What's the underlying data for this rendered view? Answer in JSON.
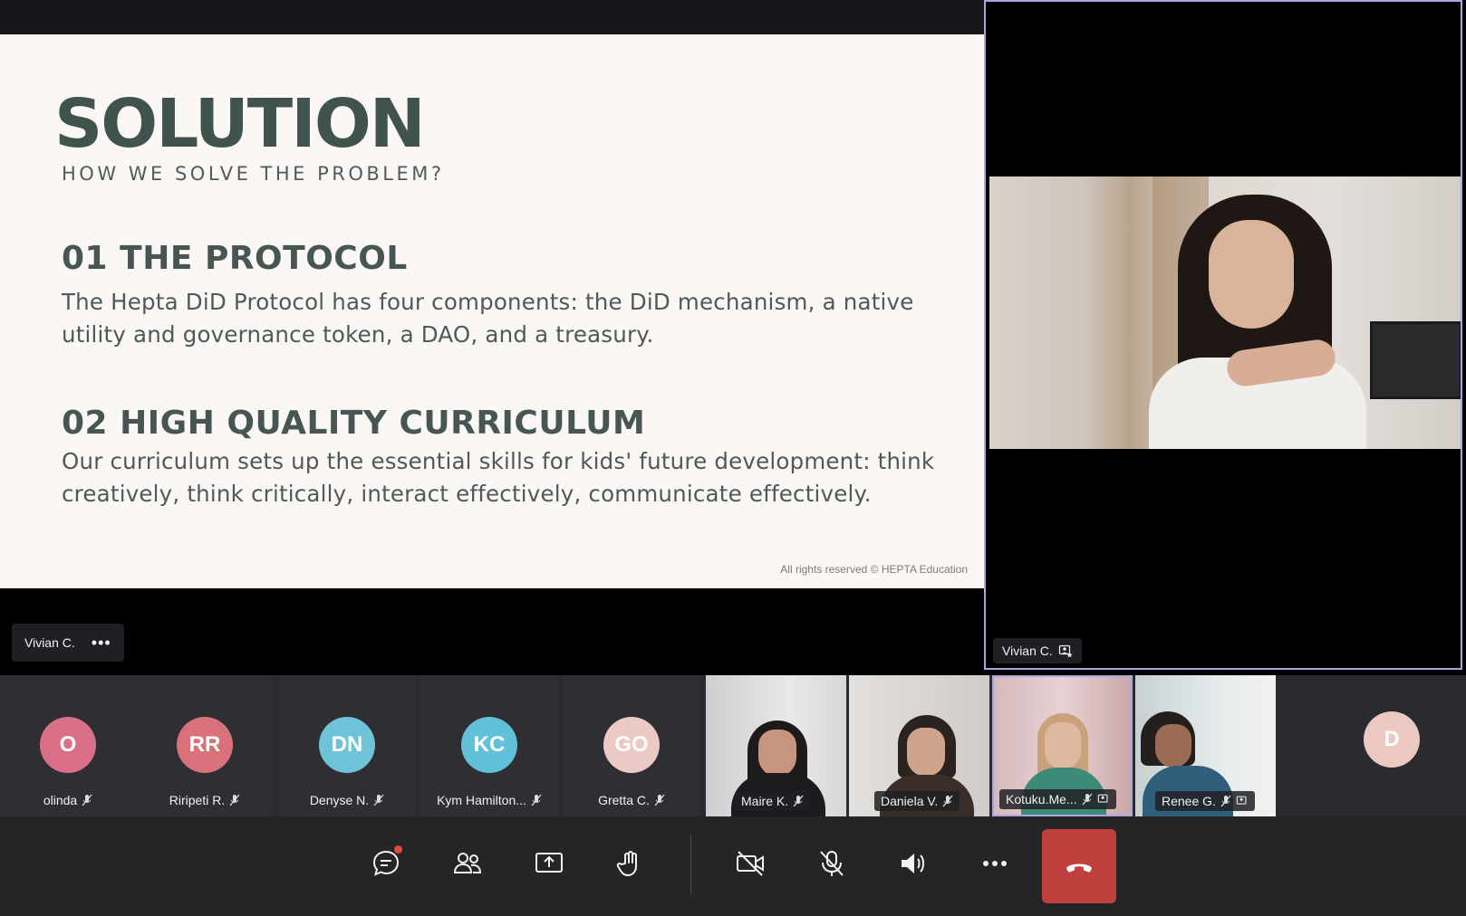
{
  "slide": {
    "title": "SOLUTION",
    "subtitle": "HOW WE SOLVE THE PROBLEM?",
    "section1_heading": "01 THE PROTOCOL",
    "section1_body": "The Hepta DiD Protocol has four components: the DiD mechanism, a native utility and governance token, a DAO, and a treasury.",
    "section2_heading": "02 HIGH QUALITY CURRICULUM",
    "section2_body": "Our curriculum sets up the essential skills for kids' future development: think creatively, think critically, interact effectively, communicate effectively.",
    "copyright": "All rights reserved © HEPTA Education"
  },
  "presenter": {
    "name": "Vivian C.",
    "more": "•••"
  },
  "speaker": {
    "name": "Vivian C."
  },
  "participants": [
    {
      "initials": "O",
      "name": "olinda",
      "color": "#d97088"
    },
    {
      "initials": "RR",
      "name": "Riripeti R.",
      "color": "#d8717a"
    },
    {
      "initials": "DN",
      "name": "Denyse N.",
      "color": "#6fc3d9"
    },
    {
      "initials": "KC",
      "name": "Kym Hamilton...",
      "color": "#62c1d8"
    },
    {
      "initials": "GO",
      "name": "Gretta C.",
      "color": "#ebc9c4"
    },
    {
      "name": "Maire K."
    },
    {
      "name": "Daniela V."
    },
    {
      "name": "Kotuku.Me..."
    },
    {
      "name": "Renee G."
    },
    {
      "initials": "D",
      "color": "#ecc8c3"
    }
  ],
  "controls": [
    "chat-icon",
    "participants-icon",
    "share-screen-icon",
    "raise-hand-icon",
    "camera-off-icon",
    "mic-off-icon",
    "speaker-icon",
    "more-icon",
    "hangup-icon"
  ]
}
